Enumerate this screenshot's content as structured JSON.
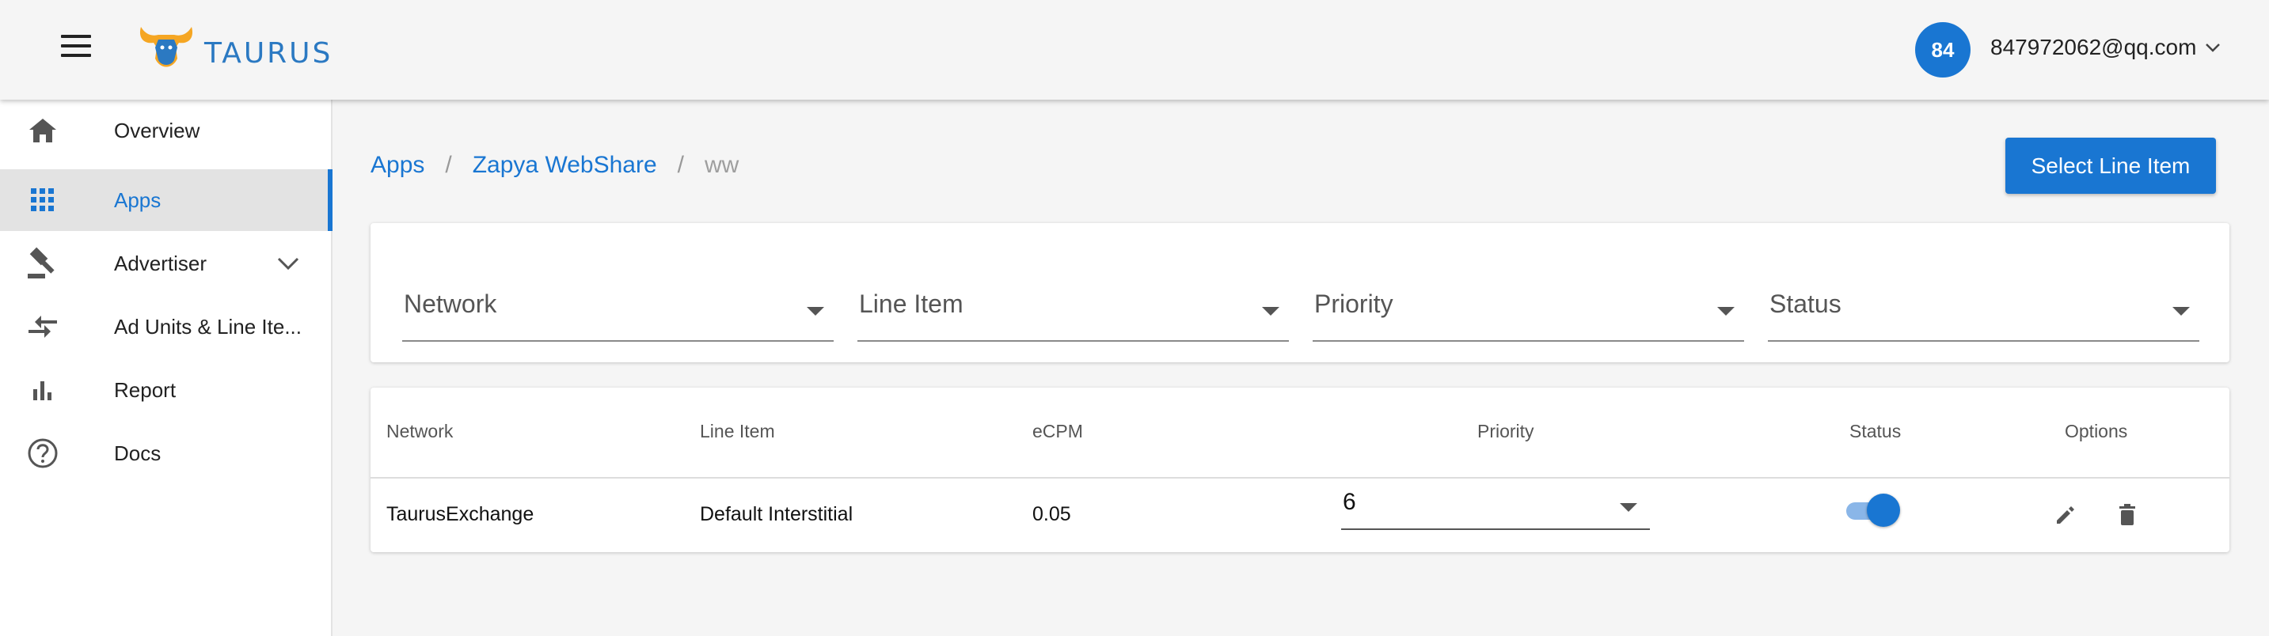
{
  "header": {
    "brand": "TAURUS",
    "avatar_initials": "84",
    "user_email": "847972062@qq.com"
  },
  "colors": {
    "accent": "#1976d2",
    "logo_orange": "#f5a623",
    "active_bg": "#e3e3e3"
  },
  "sidebar": {
    "items": [
      {
        "label": "Overview",
        "icon": "home-icon"
      },
      {
        "label": "Apps",
        "icon": "apps-grid-icon",
        "active": true
      },
      {
        "label": "Advertiser",
        "icon": "gavel-icon",
        "expandable": true
      },
      {
        "label": "Ad Units & Line Ite...",
        "icon": "compare-arrows-icon"
      },
      {
        "label": "Report",
        "icon": "bar-chart-icon"
      },
      {
        "label": "Docs",
        "icon": "help-circle-icon"
      }
    ]
  },
  "breadcrumb": {
    "apps": "Apps",
    "app_name": "Zapya WebShare",
    "current": "ww",
    "separator": "/"
  },
  "actions": {
    "select_line_item": "Select Line Item"
  },
  "filters": [
    {
      "label": "Network"
    },
    {
      "label": "Line Item"
    },
    {
      "label": "Priority"
    },
    {
      "label": "Status"
    }
  ],
  "table": {
    "columns": [
      "Network",
      "Line Item",
      "eCPM",
      "Priority",
      "Status",
      "Options"
    ],
    "rows": [
      {
        "network": "TaurusExchange",
        "line_item": "Default Interstitial",
        "ecpm": "0.05",
        "priority": "6",
        "status_enabled": true
      }
    ]
  }
}
